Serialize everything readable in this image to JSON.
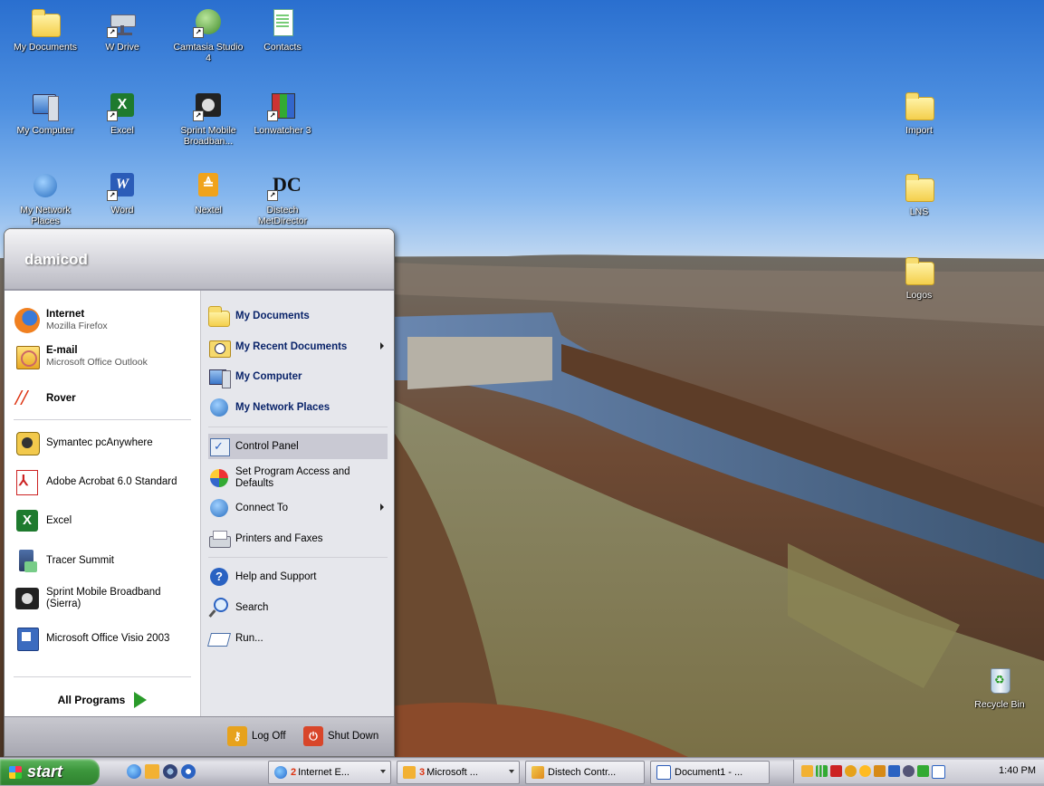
{
  "desktop": {
    "icons": [
      {
        "label": "My Documents"
      },
      {
        "label": "W Drive"
      },
      {
        "label": "Camtasia Studio 4"
      },
      {
        "label": "Contacts"
      },
      {
        "label": "My Computer"
      },
      {
        "label": "Excel"
      },
      {
        "label": "Sprint Mobile Broadban..."
      },
      {
        "label": "Lonwatcher 3"
      },
      {
        "label": "My Network Places"
      },
      {
        "label": "Word"
      },
      {
        "label": "Nextel"
      },
      {
        "label": "Distech MetDirector"
      },
      {
        "label": "Import"
      },
      {
        "label": "LNS"
      },
      {
        "label": "Logos"
      },
      {
        "label": "Recycle Bin"
      }
    ]
  },
  "start_menu": {
    "user": "damicod",
    "pinned": [
      {
        "title": "Internet",
        "subtitle": "Mozilla Firefox"
      },
      {
        "title": "E-mail",
        "subtitle": "Microsoft Office Outlook"
      },
      {
        "title": "Rover",
        "subtitle": ""
      }
    ],
    "recent": [
      {
        "label": "Symantec pcAnywhere"
      },
      {
        "label": "Adobe Acrobat 6.0 Standard"
      },
      {
        "label": "Excel"
      },
      {
        "label": "Tracer Summit"
      },
      {
        "label": "Sprint Mobile Broadband (Sierra)"
      },
      {
        "label": "Microsoft Office Visio 2003"
      }
    ],
    "all_programs": "All Programs",
    "right": [
      {
        "label": "My Documents"
      },
      {
        "label": "My Recent Documents"
      },
      {
        "label": "My Computer"
      },
      {
        "label": "My Network Places"
      },
      {
        "label": "Control Panel"
      },
      {
        "label": "Set Program Access and Defaults"
      },
      {
        "label": "Connect To"
      },
      {
        "label": "Printers and Faxes"
      },
      {
        "label": "Help and Support"
      },
      {
        "label": "Search"
      },
      {
        "label": "Run..."
      }
    ],
    "log_off": "Log Off",
    "shut_down": "Shut Down"
  },
  "taskbar": {
    "start": "start",
    "buttons": [
      {
        "count": "2",
        "label": "Internet E..."
      },
      {
        "count": "3",
        "label": "Microsoft ..."
      },
      {
        "count": "",
        "label": "Distech Contr..."
      },
      {
        "count": "",
        "label": "Document1 - ..."
      }
    ],
    "clock": "1:40 PM"
  },
  "colors": {
    "start_green": "#3c963c",
    "selection": "#c9c9d3",
    "menu_right_bg": "#e6e7ec"
  }
}
